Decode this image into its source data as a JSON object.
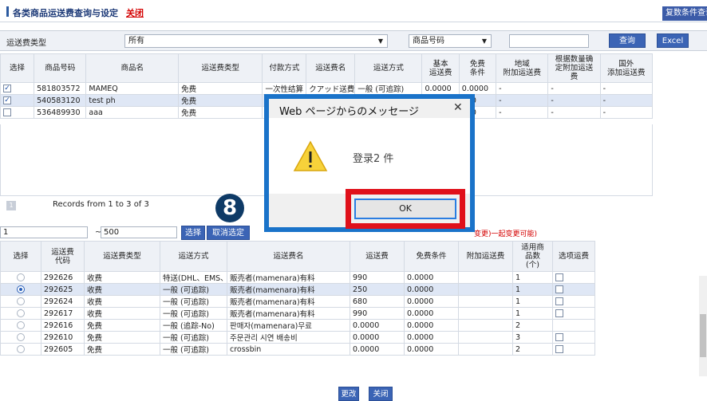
{
  "header": {
    "title": "各类商品运送费查询与设定",
    "close_label": "关闭",
    "multi_label": "复数条件查询"
  },
  "filter": {
    "type_label": "运送费类型",
    "type_value": "所有",
    "search_field": "商品号码",
    "query_label": "查询",
    "excel_label": "Excel"
  },
  "top_table": {
    "headers": [
      "选择",
      "商品号码",
      "商品名",
      "运送费类型",
      "付款方式",
      "运送费名",
      "运送方式",
      "基本\n运送费",
      "免费\n条件",
      "地域\n附加运送费",
      "根据数量确\n定附加运送\n费",
      "国外\n添加运送费"
    ],
    "rows": [
      {
        "checked": true,
        "code": "581803572",
        "name": "MAMEQ",
        "type": "免费",
        "pay": "一次性结算",
        "fee_name": "クアッド送費",
        "method": "一般 (可追踪)",
        "base": "0.0000",
        "free": "0.0000",
        "region": "-",
        "qty": "-",
        "intl": "-"
      },
      {
        "checked": true,
        "code": "540583120",
        "name": "test ph",
        "type": "免费",
        "pay": "一次",
        "fee_name": "",
        "method": "",
        "base": "",
        "free": "000",
        "region": "-",
        "qty": "-",
        "intl": "-"
      },
      {
        "checked": false,
        "code": "536489930",
        "name": "aaa",
        "type": "免费",
        "pay": "一次",
        "fee_name": "",
        "method": "",
        "base": "",
        "free": "000",
        "region": "-",
        "qty": "-",
        "intl": "-"
      }
    ]
  },
  "pager": {
    "page": "1",
    "records": "Records from 1 to 3 of 3"
  },
  "bottom_controls": {
    "from_value": "1",
    "tilde": "~",
    "to_value": "500",
    "select_label": "选择",
    "deselect_label": "取消选定",
    "note": "变更)一起变更可能)"
  },
  "bottom_table": {
    "headers": [
      "选择",
      "运送费\n代码",
      "运送费类型",
      "运送方式",
      "运送费名",
      "运送费",
      "免费条件",
      "附加运送费",
      "适用商\n品数\n(个)",
      "选项运费"
    ],
    "rows": [
      {
        "selected": false,
        "code": "292626",
        "type": "收费",
        "method": "特送(DHL、EMS、I",
        "name": "贩売者(mamenara)有料",
        "fee": "990",
        "free": "0.0000",
        "add": "",
        "count": "1",
        "opt": true
      },
      {
        "selected": true,
        "code": "292625",
        "type": "收费",
        "method": "一般 (可追踪)",
        "name": "贩売者(mamenara)有料",
        "fee": "250",
        "free": "0.0000",
        "add": "",
        "count": "1",
        "opt": true
      },
      {
        "selected": false,
        "code": "292624",
        "type": "收费",
        "method": "一般 (可追踪)",
        "name": "贩売者(mamenara)有料",
        "fee": "680",
        "free": "0.0000",
        "add": "",
        "count": "1",
        "opt": true
      },
      {
        "selected": false,
        "code": "292617",
        "type": "收费",
        "method": "一般 (可追踪)",
        "name": "贩売者(mamenara)有料",
        "fee": "990",
        "free": "0.0000",
        "add": "",
        "count": "1",
        "opt": true
      },
      {
        "selected": false,
        "code": "292616",
        "type": "免费",
        "method": "一般 (追踪-No)",
        "name": "판매자(mamenara)무료",
        "fee": "0.0000",
        "free": "0.0000",
        "add": "",
        "count": "2",
        "opt": false
      },
      {
        "selected": false,
        "code": "292610",
        "type": "免费",
        "method": "一般 (可追踪)",
        "name": "주문관리 시연 배송비",
        "fee": "0.0000",
        "free": "0.0000",
        "add": "",
        "count": "3",
        "opt": true
      },
      {
        "selected": false,
        "code": "292605",
        "type": "免费",
        "method": "一般 (可追踪)",
        "name": "crossbin",
        "fee": "0.0000",
        "free": "0.0000",
        "add": "",
        "count": "2",
        "opt": true
      }
    ]
  },
  "footer": {
    "change_label": "更改",
    "close_label": "关闭"
  },
  "dialog": {
    "title": "Web ページからのメッセージ",
    "close": "✕",
    "message": "登录2 件",
    "ok_label": "OK"
  },
  "step_badge": "8"
}
